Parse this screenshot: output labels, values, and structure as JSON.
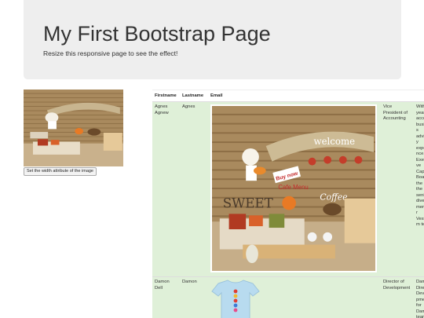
{
  "jumbotron": {
    "title": "My First Bootstrap Page",
    "subtitle": "Resize this responsive page to see the effect!"
  },
  "left_panel": {
    "image_name": "cafe-mural-image",
    "button_label": "Set the width attribute of the image"
  },
  "table": {
    "headers": [
      "Firstname",
      "Lastname",
      "Email",
      "",
      ""
    ],
    "rows": [
      {
        "firstname": "Agnes Agnew",
        "lastname": "Agnes",
        "position": "Vice President of Accounting",
        "bio": "With years account business advisory experience, the Executive Capital Board, the is the senior diverse member Vestcom team"
      },
      {
        "firstname": "Damon Dell",
        "lastname": "Damon",
        "position": "Director of Development",
        "bio": "Damon Director Development for Damon team"
      }
    ]
  },
  "mural": {
    "welcome": "welcome",
    "sweet": "SWEET",
    "coffee": "Coffee",
    "buy_now": "Buy now",
    "cafe_menu": "Cafe Menu"
  },
  "colors": {
    "jumbotron_bg": "#eeeeee",
    "success_row": "#dff0d8"
  }
}
